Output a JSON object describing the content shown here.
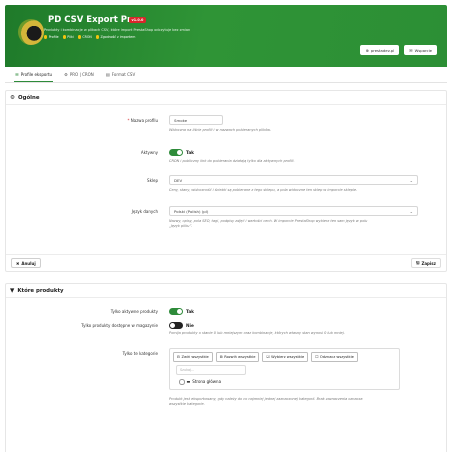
{
  "header": {
    "title": "PD CSV Export Pro",
    "badge": "v1.0.0",
    "subtitle": "Produkty i kombinacje w plikach CSV, które import PrestaShop odczytuje bez zmian",
    "tags": [
      {
        "label": "Profile"
      },
      {
        "label": "Pliki"
      },
      {
        "label": "CRON"
      },
      {
        "label": "Zgodność z importem"
      }
    ],
    "buttons": [
      {
        "label": "prestadev.pl",
        "icon": "globe-icon"
      },
      {
        "label": "Wsparcie",
        "icon": "mail-icon"
      }
    ]
  },
  "tabs": [
    {
      "label": "Profile eksportu",
      "icon": "list-icon",
      "active": true
    },
    {
      "label": "PRO | CRON",
      "icon": "gear-icon",
      "active": false
    },
    {
      "label": "Format CSV",
      "icon": "file-icon",
      "active": false
    }
  ],
  "general": {
    "heading": "Ogólne",
    "profile_name_label": "Nazwa profilu",
    "profile_name_value": "Smoke",
    "profile_name_help": "Widoczna na liście profili i w nazwach pobieranych plików.",
    "active_label": "Aktywny",
    "active_value": "Tak",
    "active_help": "CRON i publiczny link do pobierania działają tylko dla aktywnych profili.",
    "shop_label": "Sklep",
    "shop_value": "DEV",
    "shop_help": "Ceny, stany, widoczność i ścieżki są pobierane z tego sklepu, a pola widoczne ten sklep w imporcie sklepie.",
    "lang_label": "Język danych",
    "lang_value": "Polski (Polish) (pl)",
    "lang_help_1": "Nazwy, opisy, pola SEO, tagi, podpisy zdjęć i wartości cech. W imporcie PrestaShop wybierz ten sam język w polu",
    "lang_help_2": "„Język pliku”.",
    "cancel_label": "Anuluj",
    "save_label": "Zapisz"
  },
  "products": {
    "heading": "Które produkty",
    "only_active_label": "Tylko aktywne produkty",
    "only_active_value": "Tak",
    "only_available_label": "Tylko produkty dostępne w magazynie",
    "only_available_value": "Nie",
    "only_available_help": "Pomija produkty o stanie 0 lub mniejszym oraz kombinacje, których własny stan wynosi 0 lub mniej.",
    "categories_label": "Tylko te kategorie",
    "cat_buttons": [
      {
        "label": "Zwiń wszystkie",
        "icon": "collapse-icon"
      },
      {
        "label": "Rozwiń wszystkie",
        "icon": "expand-icon"
      },
      {
        "label": "Wybierz wszystkie",
        "icon": "check-square-icon"
      },
      {
        "label": "Odznacz wszystkie",
        "icon": "square-icon"
      }
    ],
    "cat_search_placeholder": "Szukaj...",
    "cat_root": "Strona główna",
    "categories_help_1": "Produkt jest eksportowany, gdy należy do co najmniej jednej zaznaczonej kategorii. Brak zaznaczenia oznacza",
    "categories_help_2": "wszystkie kategorie."
  }
}
